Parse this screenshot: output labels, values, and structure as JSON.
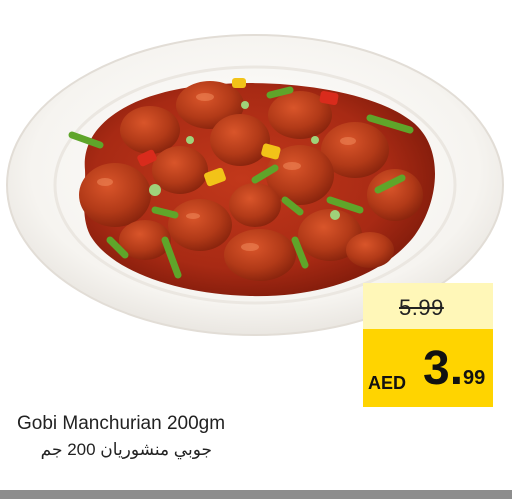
{
  "product": {
    "image_icon": "gobi-manchurian-plate-photo",
    "name_en": "Gobi Manchurian 200gm",
    "name_ar": "جوبي منشوريان 200 جم"
  },
  "price": {
    "old": "5.99",
    "currency": "AED",
    "new_int": "3.",
    "new_dec": "99"
  },
  "colors": {
    "tag_yellow": "#ffd400",
    "tag_light": "#fff7b8",
    "sauce": "#a82a14",
    "plate": "#f4f1ec",
    "bottom_bar": "#8d8d8d"
  }
}
